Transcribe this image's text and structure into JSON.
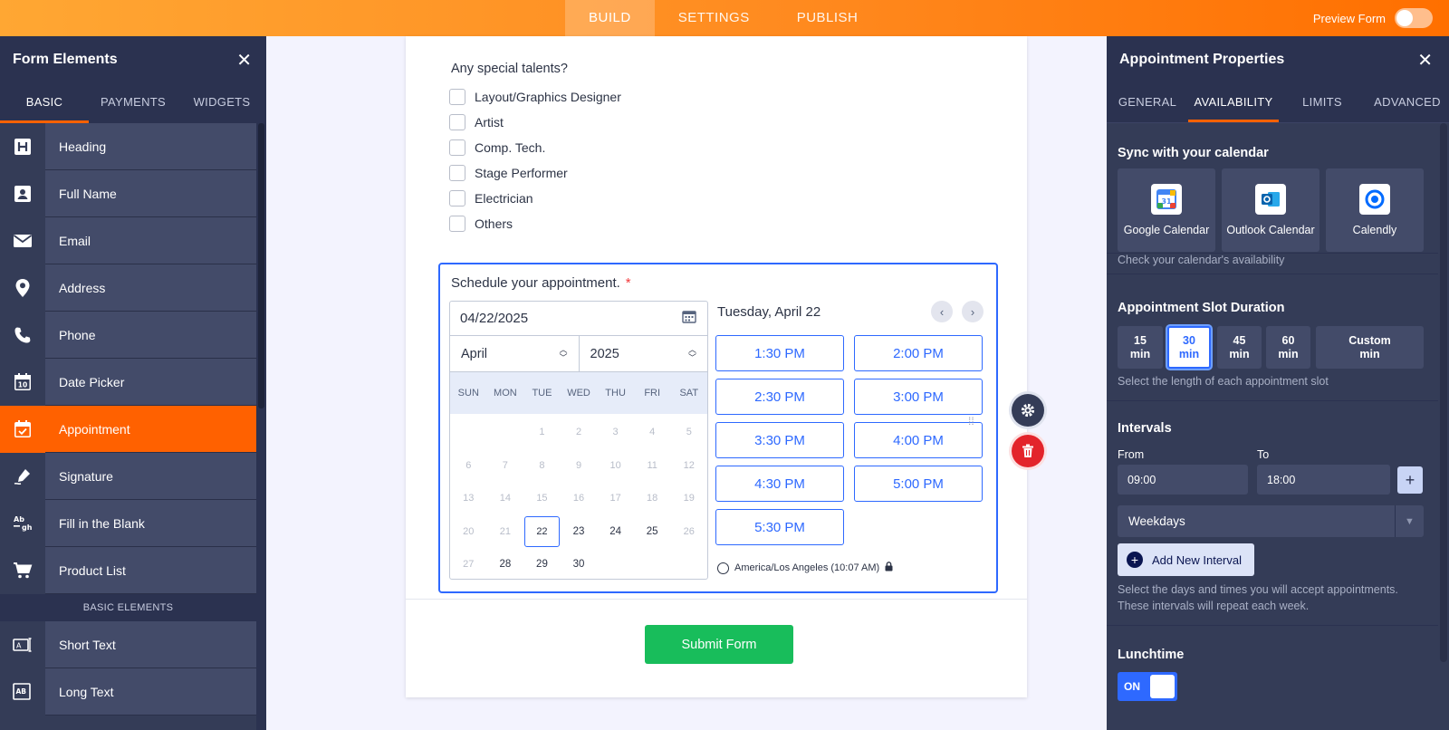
{
  "topbar": {
    "tabs": [
      "BUILD",
      "SETTINGS",
      "PUBLISH"
    ],
    "preview_label": "Preview Form"
  },
  "left_panel": {
    "title": "Form Elements",
    "tabs": [
      "BASIC",
      "PAYMENTS",
      "WIDGETS"
    ],
    "items": [
      {
        "label": "Heading",
        "icon": "heading-icon"
      },
      {
        "label": "Full Name",
        "icon": "person-card-icon"
      },
      {
        "label": "Email",
        "icon": "envelope-icon"
      },
      {
        "label": "Address",
        "icon": "map-pin-icon"
      },
      {
        "label": "Phone",
        "icon": "phone-icon"
      },
      {
        "label": "Date Picker",
        "icon": "calendar-icon"
      },
      {
        "label": "Appointment",
        "icon": "calendar-check-icon"
      },
      {
        "label": "Signature",
        "icon": "pen-icon"
      },
      {
        "label": "Fill in the Blank",
        "icon": "fill-blank-icon"
      },
      {
        "label": "Product List",
        "icon": "cart-icon"
      }
    ],
    "section_label": "BASIC ELEMENTS",
    "items2": [
      {
        "label": "Short Text",
        "icon": "short-text-icon"
      },
      {
        "label": "Long Text",
        "icon": "long-text-icon"
      }
    ]
  },
  "form": {
    "talents_question": "Any special talents?",
    "talents": [
      "Layout/Graphics Designer",
      "Artist",
      "Comp. Tech.",
      "Stage Performer",
      "Electrician",
      "Others"
    ],
    "appointment": {
      "title": "Schedule your appointment.",
      "required_mark": "*",
      "date_value": "04/22/2025",
      "month": "April",
      "year": "2025",
      "weekdays": [
        "SUN",
        "MON",
        "TUE",
        "WED",
        "THU",
        "FRI",
        "SAT"
      ],
      "weeks": [
        [
          "",
          "",
          "1",
          "2",
          "3",
          "4",
          "5"
        ],
        [
          "6",
          "7",
          "8",
          "9",
          "10",
          "11",
          "12"
        ],
        [
          "13",
          "14",
          "15",
          "16",
          "17",
          "18",
          "19"
        ],
        [
          "20",
          "21",
          "22",
          "23",
          "24",
          "25",
          "26"
        ],
        [
          "27",
          "28",
          "29",
          "30",
          "",
          "",
          ""
        ]
      ],
      "selected_day": "22",
      "day_header": "Tuesday, April 22",
      "slots": [
        "1:30 PM",
        "2:00 PM",
        "2:30 PM",
        "3:00 PM",
        "3:30 PM",
        "4:00 PM",
        "4:30 PM",
        "5:00 PM",
        "5:30 PM"
      ],
      "timezone": "America/Los Angeles (10:07 AM)"
    },
    "submit_label": "Submit Form"
  },
  "right_panel": {
    "title": "Appointment Properties",
    "tabs": [
      "GENERAL",
      "AVAILABILITY",
      "LIMITS",
      "ADVANCED"
    ],
    "sync": {
      "title": "Sync with your calendar",
      "cards": [
        "Google Calendar",
        "Outlook Calendar",
        "Calendly"
      ],
      "help": "Check your calendar's availability"
    },
    "duration": {
      "title": "Appointment Slot Duration",
      "options": [
        [
          "15",
          "min"
        ],
        [
          "30",
          "min"
        ],
        [
          "45",
          "min"
        ],
        [
          "60",
          "min"
        ],
        [
          "Custom",
          "min"
        ]
      ],
      "selected": "30",
      "help": "Select the length of each appointment slot"
    },
    "intervals": {
      "title": "Intervals",
      "from_label": "From",
      "to_label": "To",
      "from_value": "09:00",
      "to_value": "18:00",
      "days_value": "Weekdays",
      "add_label": "Add New Interval",
      "help_line1": "Select the days and times you will accept appointments.",
      "help_line2": "These intervals will repeat each week."
    },
    "lunchtime": {
      "title": "Lunchtime",
      "toggle_label": "ON"
    }
  },
  "colors": {
    "accent_orange": "#ff6100",
    "accent_blue": "#2e69ff",
    "submit_green": "#18bd5b",
    "delete_red": "#e3242b"
  }
}
